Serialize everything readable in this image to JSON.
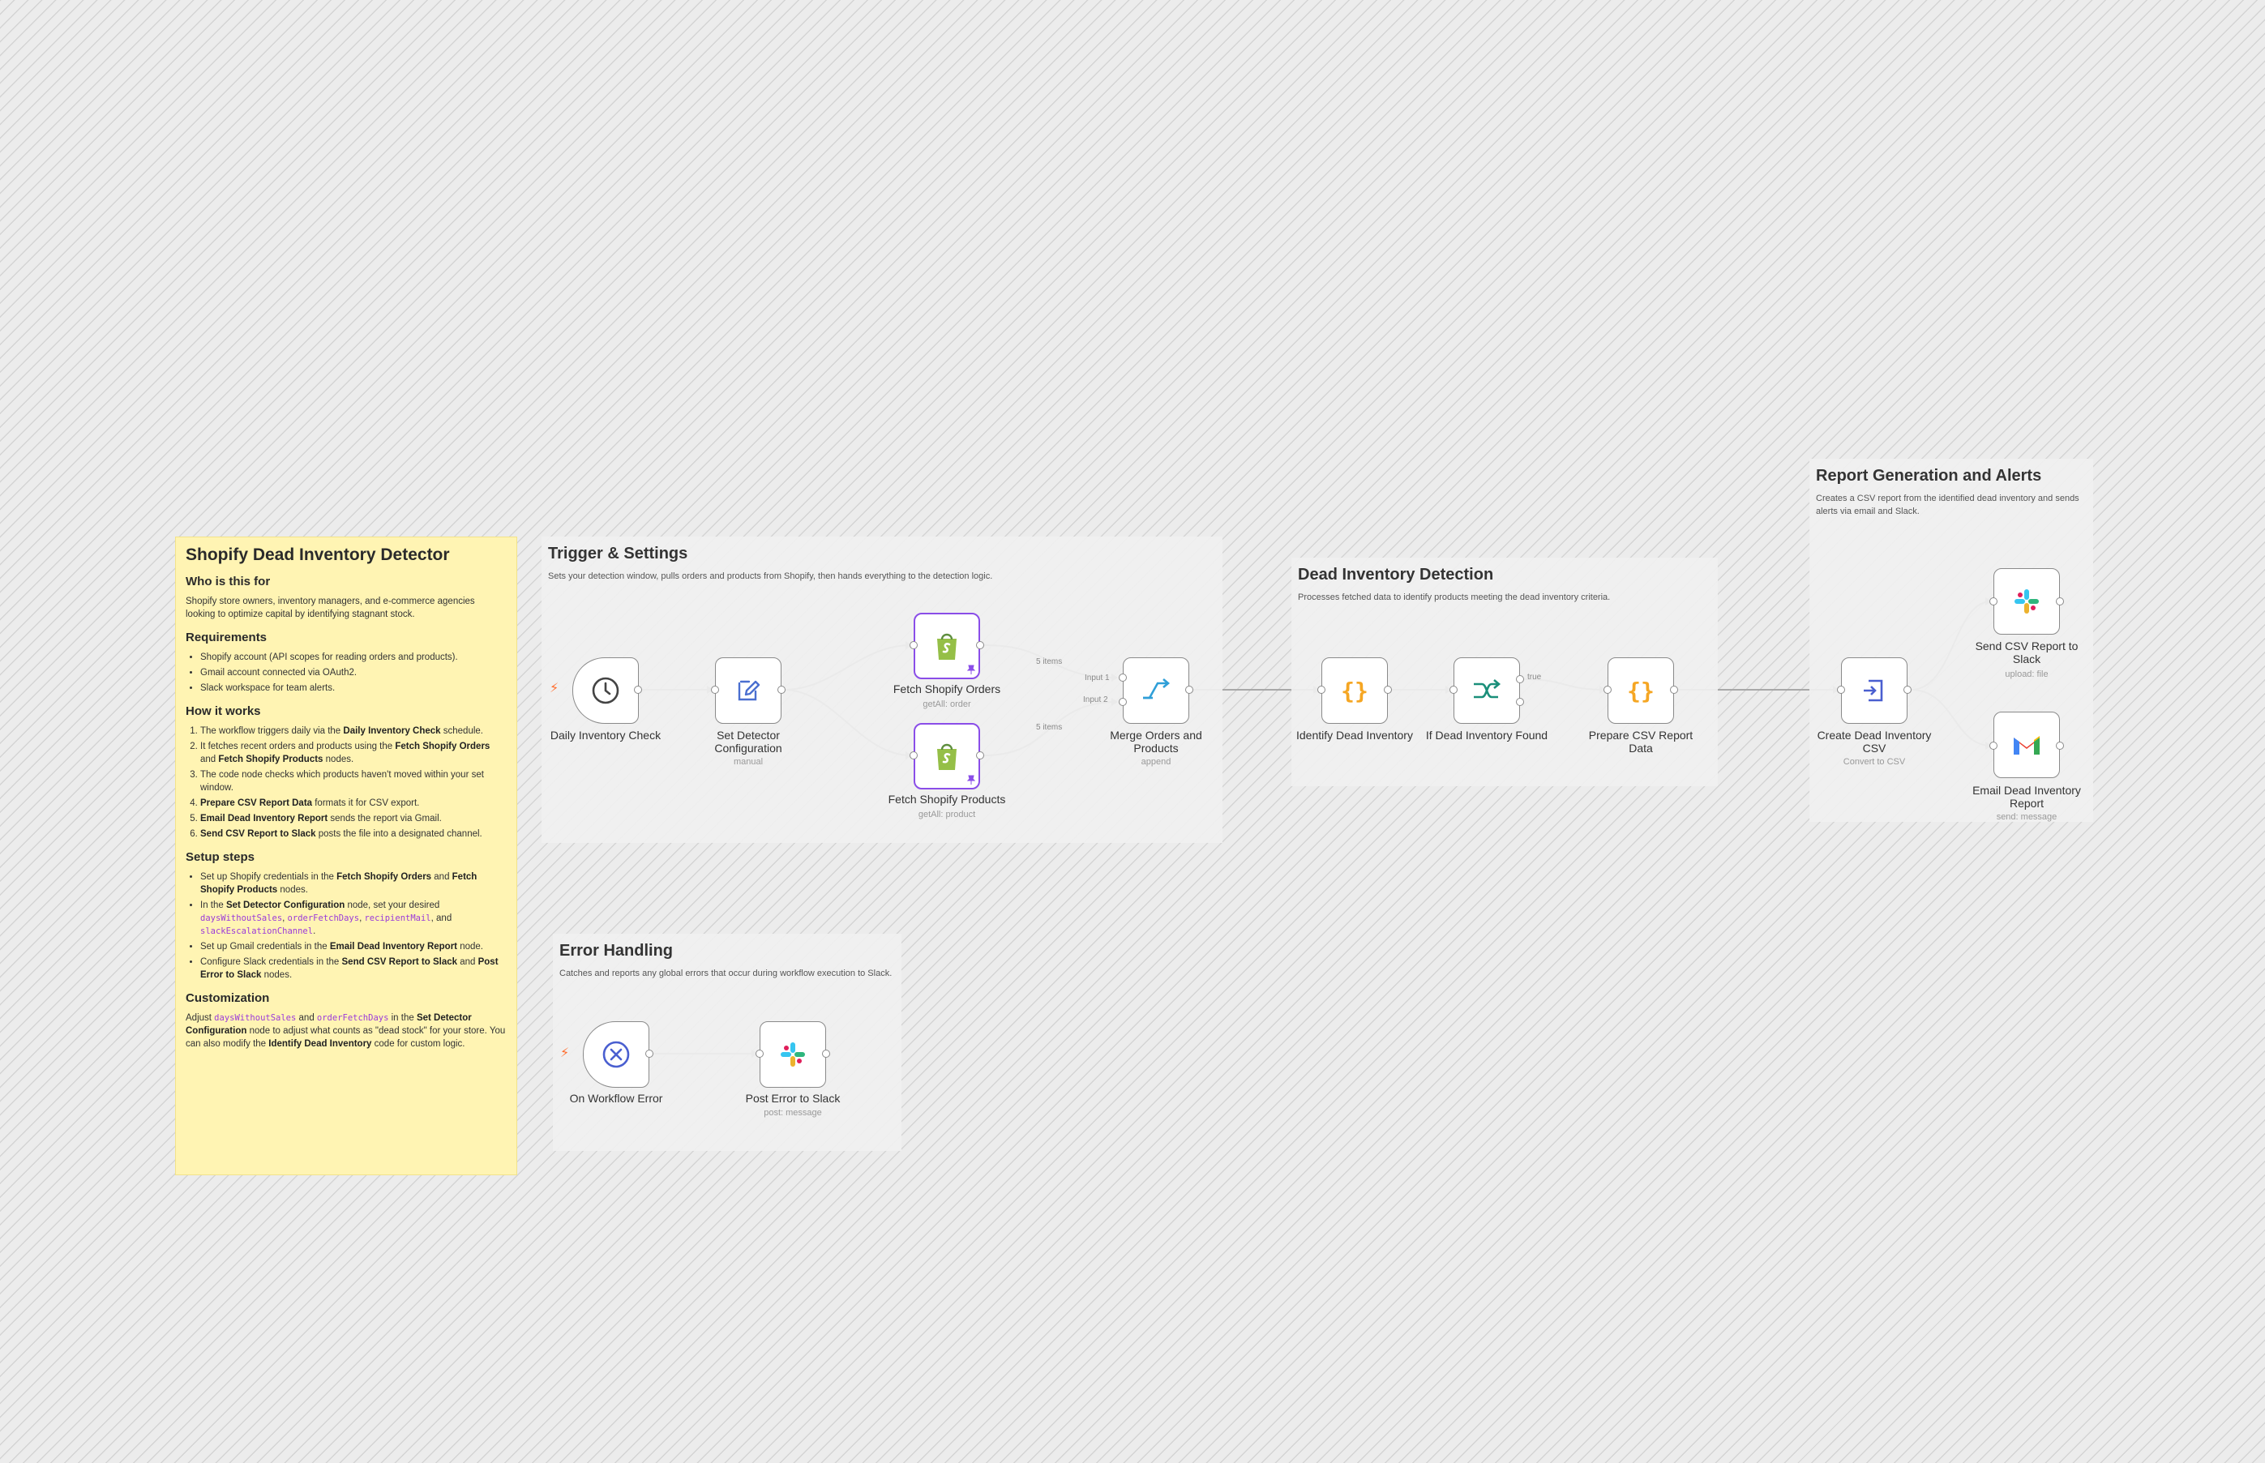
{
  "note": {
    "title": "Shopify Dead Inventory Detector",
    "who_heading": "Who is this for",
    "who_text": "Shopify store owners, inventory managers, and e-commerce agencies looking to optimize capital by identifying stagnant stock.",
    "req_heading": "Requirements",
    "req_items": [
      "Shopify account (API scopes for reading orders and products).",
      "Gmail account connected via OAuth2.",
      "Slack workspace for team alerts."
    ],
    "how_heading": "How it works",
    "how_1a": "The workflow triggers daily via the ",
    "how_1b": "Daily Inventory Check",
    "how_1c": " schedule.",
    "how_2a": "It fetches recent orders and products using the ",
    "how_2b": "Fetch Shopify Orders",
    "how_2c": " and ",
    "how_2d": "Fetch Shopify Products",
    "how_2e": " nodes.",
    "how_3": "The code node checks which products haven't moved within your set window.",
    "how_4a": "Prepare CSV Report Data",
    "how_4b": " formats it for CSV export.",
    "how_5a": "Email Dead Inventory Report",
    "how_5b": " sends the report via Gmail.",
    "how_6a": "Send CSV Report to Slack",
    "how_6b": " posts the file into a designated channel.",
    "setup_heading": "Setup steps",
    "setup_1a": "Set up Shopify credentials in the ",
    "setup_1b": "Fetch Shopify Orders",
    "setup_1c": " and ",
    "setup_1d": "Fetch Shopify Products",
    "setup_1e": " nodes.",
    "setup_2a": "In the ",
    "setup_2b": "Set Detector Configuration",
    "setup_2c": " node, set your desired ",
    "setup_2d": "daysWithoutSales",
    "setup_2e": ", ",
    "setup_2f": "orderFetchDays",
    "setup_2g": ", ",
    "setup_2h": "recipientMail",
    "setup_2i": ", and ",
    "setup_2j": "slackEscalationChannel",
    "setup_2k": ".",
    "setup_3a": "Set up Gmail credentials in the ",
    "setup_3b": "Email Dead Inventory Report",
    "setup_3c": " node.",
    "setup_4a": "Configure Slack credentials in the ",
    "setup_4b": "Send CSV Report to Slack",
    "setup_4c": " and ",
    "setup_4d": "Post Error to Slack",
    "setup_4e": " nodes.",
    "custom_heading": "Customization",
    "custom_a": "Adjust ",
    "custom_b": "daysWithoutSales",
    "custom_c": " and ",
    "custom_d": "orderFetchDays",
    "custom_e": " in the ",
    "custom_f": "Set Detector Configuration",
    "custom_g": " node to adjust what counts as \"dead stock\" for your store. You can also modify the ",
    "custom_h": "Identify Dead Inventory",
    "custom_i": " code for custom logic."
  },
  "groups": {
    "trigger": {
      "title": "Trigger & Settings",
      "desc": "Sets your detection window, pulls orders and products from Shopify, then hands everything to the detection logic."
    },
    "detect": {
      "title": "Dead Inventory Detection",
      "desc": "Processes fetched data to identify products meeting the dead inventory criteria."
    },
    "report": {
      "title": "Report Generation and Alerts",
      "desc": "Creates a CSV report from the identified dead inventory and sends alerts via email and Slack."
    },
    "error": {
      "title": "Error Handling",
      "desc": "Catches and reports any global errors that occur during workflow execution to Slack."
    }
  },
  "nodes": {
    "daily": {
      "label": "Daily Inventory Check"
    },
    "config": {
      "label": "Set Detector Configuration",
      "sub": "manual"
    },
    "orders": {
      "label": "Fetch Shopify Orders",
      "sub": "getAll: order"
    },
    "products": {
      "label": "Fetch Shopify Products",
      "sub": "getAll: product"
    },
    "merge": {
      "label": "Merge Orders and Products",
      "sub": "append"
    },
    "identify": {
      "label": "Identify Dead Inventory"
    },
    "iffound": {
      "label": "If Dead Inventory Found"
    },
    "prepare": {
      "label": "Prepare CSV Report Data"
    },
    "csv": {
      "label": "Create Dead Inventory CSV",
      "sub": "Convert to CSV"
    },
    "slackcsv": {
      "label": "Send CSV Report to Slack",
      "sub": "upload: file"
    },
    "email": {
      "label": "Email Dead Inventory Report",
      "sub": "send: message"
    },
    "onerror": {
      "label": "On Workflow Error"
    },
    "posterror": {
      "label": "Post Error to Slack",
      "sub": "post: message"
    }
  },
  "edges": {
    "orders_items": "5 items",
    "products_items": "5 items",
    "input1": "Input 1",
    "input2": "Input 2",
    "true": "true"
  },
  "colors": {
    "shopify_border": "#8a4de8",
    "trigger_bolt": "#ff6d2d",
    "code_brace": "#f5a623",
    "if_icon": "#1a8f7a",
    "note_bg": "#fff4b3"
  }
}
